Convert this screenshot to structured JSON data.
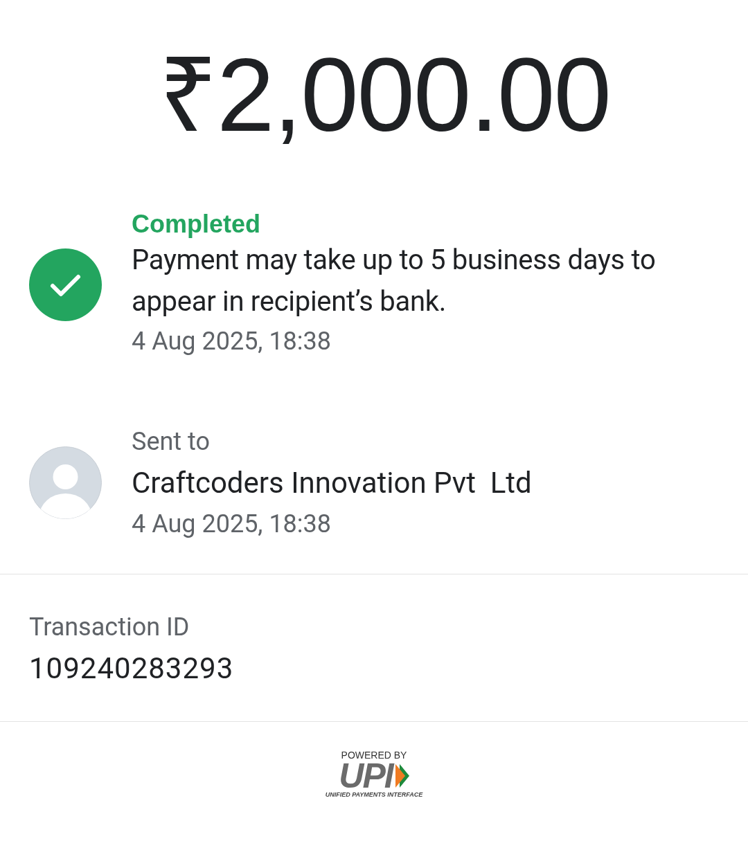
{
  "amount": "₹2,000.00",
  "status": {
    "kind": "completed",
    "label": "Completed",
    "message": "Payment may take up to 5 business days to appear in recipient’s bank.",
    "time": "4 Aug 2025, 18:38"
  },
  "recipient": {
    "caption": "Sent to",
    "name": "Craftcoders Innovation Pvt  Ltd",
    "time": "4 Aug 2025, 18:38"
  },
  "transaction": {
    "label": "Transaction ID",
    "value": "109240283293"
  },
  "footer": {
    "powered_by": "POWERED BY",
    "logo_text": "UPI",
    "tagline": "UNIFIED PAYMENTS INTERFACE"
  }
}
